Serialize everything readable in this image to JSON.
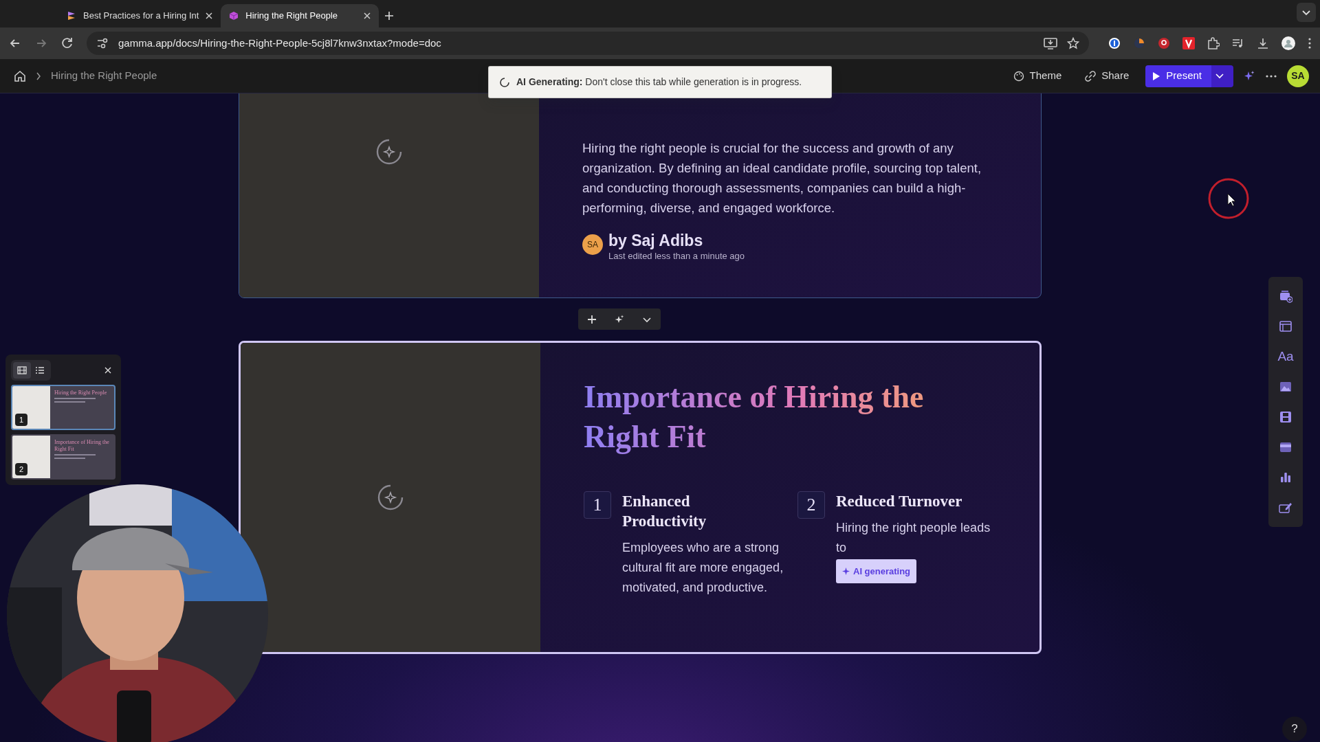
{
  "browser": {
    "tabs": [
      {
        "title": "Best Practices for a Hiring Int",
        "selected": false
      },
      {
        "title": "Hiring the Right People",
        "selected": true
      }
    ],
    "url": "gamma.app/docs/Hiring-the-Right-People-5cj8l7knw3nxtax?mode=doc"
  },
  "header": {
    "breadcrumb": "Hiring the Right People",
    "actions": [
      "Theme",
      "Share"
    ],
    "present": "Present",
    "avatar": "SA"
  },
  "toast": "**AI Generating:** Don't close this tab while generation is in progress.",
  "cards": [
    {
      "selected": false,
      "body": "Hiring the right people is crucial for the success and growth of any organization. By defining an ideal candidate profile, sourcing top talent, and conducting thorough assessments, companies can build a high-performing, diverse, and engaged workforce.",
      "author": {
        "initials": "SA",
        "name": "by Saj Adibs",
        "edited": "Last edited less than a minute ago"
      }
    },
    {
      "title": "Importance of Hiring the Right Fit",
      "selected": true,
      "items": [
        {
          "number": "1",
          "heading": "Enhanced Productivity",
          "body": "Employees who are a strong cultural fit are more engaged, motivated, and productive."
        },
        {
          "number": "2",
          "heading": "Reduced Turnover",
          "body": "Hiring the right people leads to",
          "badge": "AI generating"
        }
      ]
    }
  ],
  "thumbnails": [
    {
      "number": "1",
      "title": "Hiring the Right People",
      "selected": true
    },
    {
      "number": "2",
      "title": "Importance of Hiring the Right Fit",
      "selected": false
    }
  ],
  "view_modes": [
    {
      "kind": "grid",
      "selected": true
    },
    {
      "kind": "list",
      "selected": false
    }
  ],
  "tools": {
    "text_tool": "Aa"
  },
  "help": "?"
}
